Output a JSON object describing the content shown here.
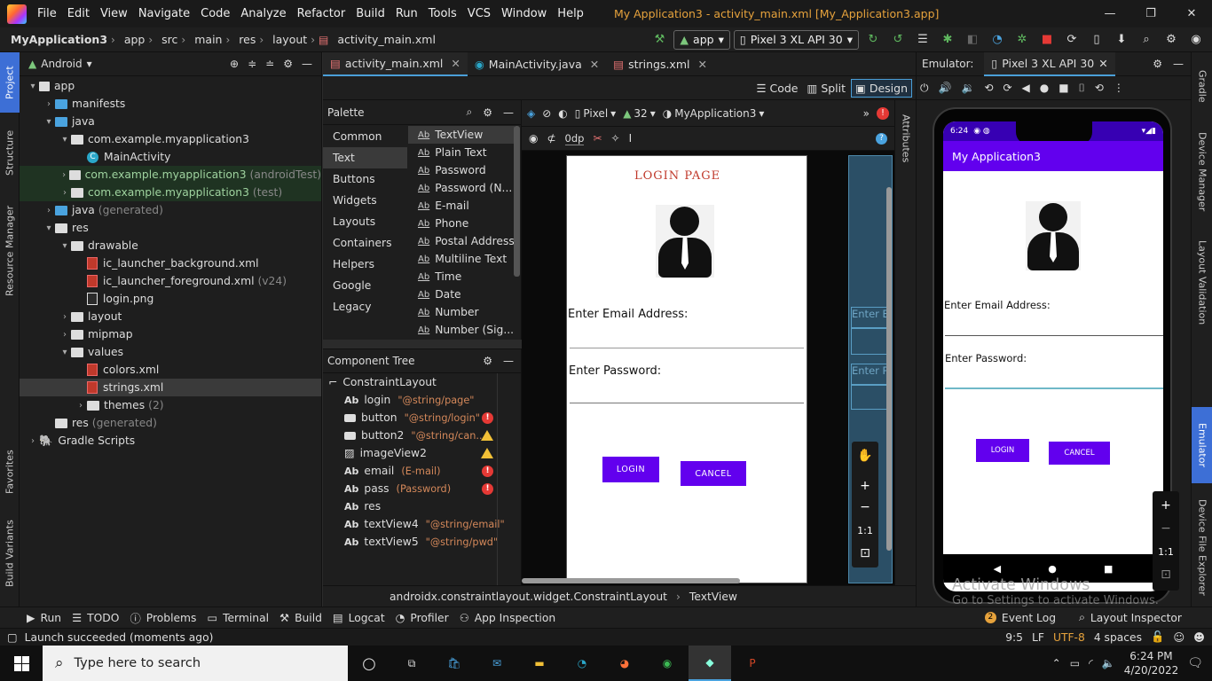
{
  "menu": {
    "items": [
      "File",
      "Edit",
      "View",
      "Navigate",
      "Code",
      "Analyze",
      "Refactor",
      "Build",
      "Run",
      "Tools",
      "VCS",
      "Window",
      "Help"
    ],
    "title": "My Application3 - activity_main.xml [My_Application3.app]"
  },
  "nav": {
    "crumbs": [
      "MyApplication3",
      "app",
      "src",
      "main",
      "res",
      "layout",
      "activity_main.xml"
    ],
    "config": "app",
    "device": "Pixel 3 XL API 30"
  },
  "left_strip": [
    "Project",
    "Structure",
    "Resource Manager",
    "Favorites",
    "Build Variants"
  ],
  "project": {
    "view": "Android",
    "tree": [
      {
        "label": "app",
        "indent": 0,
        "arrow": "▾",
        "icon": "module"
      },
      {
        "label": "manifests",
        "indent": 1,
        "arrow": "›",
        "icon": "folder"
      },
      {
        "label": "java",
        "indent": 1,
        "arrow": "▾",
        "icon": "folder"
      },
      {
        "label": "com.example.myapplication3",
        "indent": 2,
        "arrow": "▾",
        "icon": "package"
      },
      {
        "label": "MainActivity",
        "indent": 3,
        "arrow": "",
        "icon": "class"
      },
      {
        "label": "com.example.myapplication3",
        "suffix": "(androidTest)",
        "indent": 2,
        "arrow": "›",
        "icon": "package",
        "hl": true
      },
      {
        "label": "com.example.myapplication3",
        "suffix": "(test)",
        "indent": 2,
        "arrow": "›",
        "icon": "package",
        "hl": true
      },
      {
        "label": "java",
        "suffix": "(generated)",
        "indent": 1,
        "arrow": "›",
        "icon": "folder"
      },
      {
        "label": "res",
        "indent": 1,
        "arrow": "▾",
        "icon": "resfolder"
      },
      {
        "label": "drawable",
        "indent": 2,
        "arrow": "▾",
        "icon": "resfolder"
      },
      {
        "label": "ic_launcher_background.xml",
        "indent": 3,
        "arrow": "",
        "icon": "xml"
      },
      {
        "label": "ic_launcher_foreground.xml",
        "suffix": "(v24)",
        "indent": 3,
        "arrow": "",
        "icon": "xml"
      },
      {
        "label": "login.png",
        "indent": 3,
        "arrow": "",
        "icon": "img"
      },
      {
        "label": "layout",
        "indent": 2,
        "arrow": "›",
        "icon": "resfolder"
      },
      {
        "label": "mipmap",
        "indent": 2,
        "arrow": "›",
        "icon": "resfolder"
      },
      {
        "label": "values",
        "indent": 2,
        "arrow": "▾",
        "icon": "resfolder"
      },
      {
        "label": "colors.xml",
        "indent": 3,
        "arrow": "",
        "icon": "xml"
      },
      {
        "label": "strings.xml",
        "indent": 3,
        "arrow": "",
        "icon": "xml",
        "sel": true
      },
      {
        "label": "themes",
        "suffix": "(2)",
        "indent": 3,
        "arrow": "›",
        "icon": "resfolder"
      },
      {
        "label": "res",
        "suffix": "(generated)",
        "indent": 1,
        "arrow": "",
        "icon": "resfolder"
      },
      {
        "label": "Gradle Scripts",
        "indent": 0,
        "arrow": "›",
        "icon": "gradle"
      }
    ]
  },
  "editor_tabs": [
    {
      "label": "activity_main.xml",
      "active": true
    },
    {
      "label": "MainActivity.java",
      "active": false
    },
    {
      "label": "strings.xml",
      "active": false
    }
  ],
  "view_modes": [
    "Code",
    "Split",
    "Design"
  ],
  "palette": {
    "title": "Palette",
    "categories": [
      "Common",
      "Text",
      "Buttons",
      "Widgets",
      "Layouts",
      "Containers",
      "Helpers",
      "Google",
      "Legacy"
    ],
    "selected_category": "Text",
    "items": [
      "TextView",
      "Plain Text",
      "Password",
      "Password (N...",
      "E-mail",
      "Phone",
      "Postal Address",
      "Multiline Text",
      "Time",
      "Date",
      "Number",
      "Number (Sig..."
    ]
  },
  "component_tree": {
    "title": "Component Tree",
    "root": "ConstraintLayout",
    "rows": [
      {
        "icon": "Ab",
        "name": "login",
        "value": "\"@string/page\"",
        "badge": ""
      },
      {
        "icon": "btn",
        "name": "button",
        "value": "\"@string/login\"",
        "badge": "error"
      },
      {
        "icon": "btn",
        "name": "button2",
        "value": "\"@string/can...",
        "badge": "warn"
      },
      {
        "icon": "img",
        "name": "imageView2",
        "value": "",
        "badge": "warn"
      },
      {
        "icon": "Ab",
        "name": "email",
        "value": "(E-mail)",
        "badge": "error"
      },
      {
        "icon": "Ab",
        "name": "pass",
        "value": "(Password)",
        "badge": "error"
      },
      {
        "icon": "Ab",
        "name": "res",
        "value": "",
        "badge": ""
      },
      {
        "icon": "Ab",
        "name": "textView4",
        "value": "\"@string/email\"",
        "badge": ""
      },
      {
        "icon": "Ab",
        "name": "textView5",
        "value": "\"@string/pwd\"",
        "badge": ""
      }
    ]
  },
  "design_toolbar": {
    "device": "Pixel",
    "api": "32",
    "theme": "MyApplication3",
    "margin": "0dp"
  },
  "design_preview": {
    "title": "LOGIN PAGE",
    "email_label": "Enter Email Address:",
    "password_label": "Enter Password:",
    "login_button": "LOGIN",
    "cancel_button": "CANCEL",
    "blueprint_email": "Enter E",
    "blueprint_pass": "Enter P"
  },
  "attributes_label": "Attributes",
  "breadcrumb": [
    "androidx.constraintlayout.widget.ConstraintLayout",
    "TextView"
  ],
  "emulator": {
    "label": "Emulator:",
    "tab": "Pixel 3 XL API 30",
    "time": "6:24",
    "app_title": "My Application3",
    "email_label": "Enter Email Address:",
    "password_label": "Enter Password:",
    "login_button": "LOGIN",
    "cancel_button": "CANCEL",
    "zoom_reset": "1:1"
  },
  "right_strip": [
    "Gradle",
    "Device Manager",
    "Layout Validation",
    "Emulator",
    "Device File Explorer"
  ],
  "watermark": {
    "line1": "Activate Windows",
    "line2": "Go to Settings to activate Windows."
  },
  "tool_windows": [
    "Run",
    "TODO",
    "Problems",
    "Terminal",
    "Build",
    "Logcat",
    "Profiler",
    "App Inspection"
  ],
  "tool_windows_right": {
    "event_log_count": "2",
    "event_log": "Event Log",
    "layout_inspector": "Layout Inspector"
  },
  "status": {
    "message": "Launch succeeded (moments ago)",
    "position": "9:5",
    "line_sep": "LF",
    "encoding": "UTF-8",
    "indent": "4 spaces"
  },
  "taskbar": {
    "search_placeholder": "Type here to search",
    "time": "6:24 PM",
    "date": "4/20/2022"
  },
  "colors": {
    "accent": "#6200ee",
    "title_red": "#c0392b",
    "link_orange": "#d4885a"
  }
}
